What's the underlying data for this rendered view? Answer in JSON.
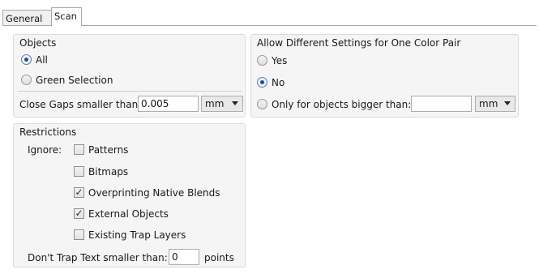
{
  "tabs": [
    {
      "label": "General",
      "active": false
    },
    {
      "label": "Scan",
      "active": true
    }
  ],
  "objects_group": {
    "title": "Objects",
    "options": [
      {
        "label": "All",
        "selected": true
      },
      {
        "label": "Green Selection",
        "selected": false
      }
    ],
    "close_gaps": {
      "label": "Close Gaps smaller than:",
      "value": "0.005",
      "unit": "mm"
    }
  },
  "color_pair_group": {
    "title": "Allow Different Settings for One Color Pair",
    "options": [
      {
        "label": "Yes",
        "selected": false
      },
      {
        "label": "No",
        "selected": true
      },
      {
        "label": "Only for objects bigger than:",
        "selected": false
      }
    ],
    "size_value": "",
    "unit": "mm"
  },
  "restrictions_group": {
    "title": "Restrictions",
    "ignore_label": "Ignore:",
    "items": [
      {
        "label": "Patterns",
        "checked": false
      },
      {
        "label": "Bitmaps",
        "checked": false
      },
      {
        "label": "Overprinting Native Blends",
        "checked": true
      },
      {
        "label": "External Objects",
        "checked": true
      },
      {
        "label": "Existing Trap Layers",
        "checked": false
      }
    ],
    "dont_trap": {
      "label": "Don't Trap Text smaller than:",
      "value": "0",
      "unit": "points"
    }
  },
  "check_glyph": "✓"
}
